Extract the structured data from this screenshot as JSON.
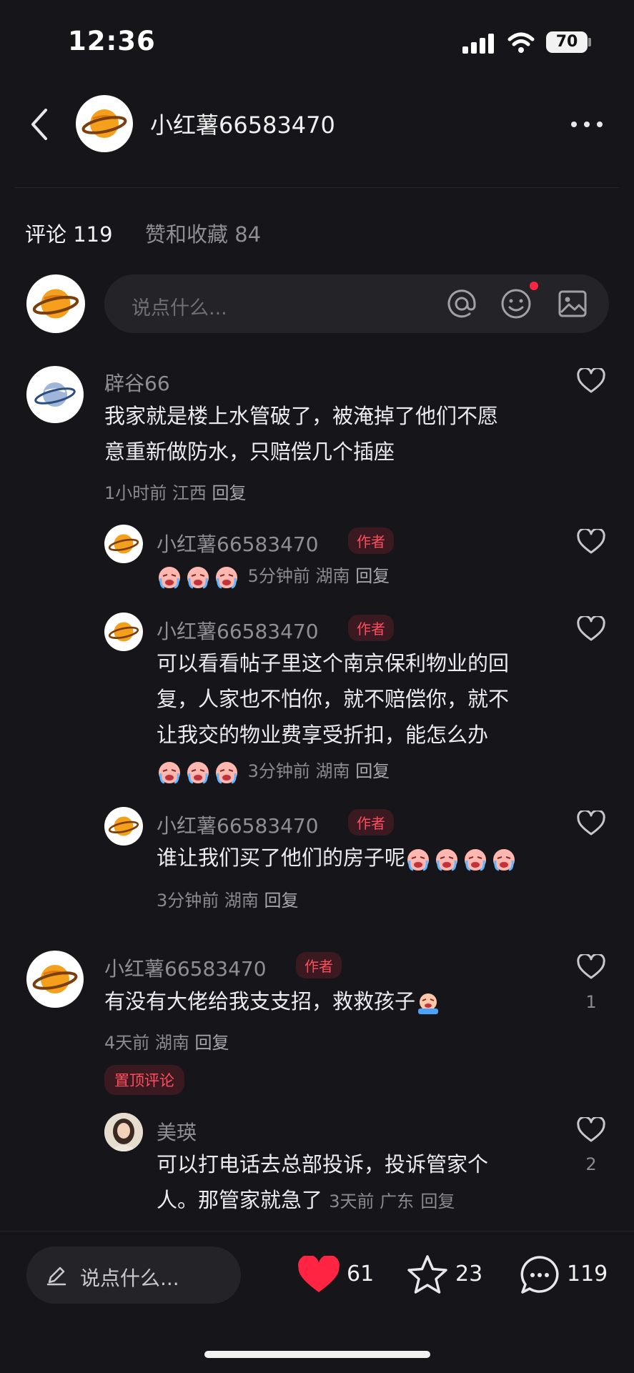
{
  "status_bar": {
    "time": "12:36",
    "battery": "70"
  },
  "header": {
    "title": "小红薯66583470"
  },
  "tabs": {
    "comments": "评论 119",
    "likes_collects": "赞和收藏 84"
  },
  "comment_input": {
    "placeholder": "说点什么..."
  },
  "comments": [
    {
      "name": "辟谷66",
      "text_line1": "我家就是楼上水管破了，被淹掉了他们不愿",
      "text_line2": "意重新做防水，只赔偿几个插座",
      "meta": "1小时前 江西",
      "reply": "回复",
      "replies": [
        {
          "name": "小红薯66583470",
          "tag": "作者",
          "meta": "5分钟前 湖南",
          "reply": "回复"
        },
        {
          "name": "小红薯66583470",
          "tag": "作者",
          "text_line1": "可以看看帖子里这个南京保利物业的回",
          "text_line2": "复，人家也不怕你，就不赔偿你，就不",
          "text_line3": "让我交的物业费享受折扣，能怎么办",
          "meta": "3分钟前 湖南",
          "reply": "回复"
        },
        {
          "name": "小红薯66583470",
          "tag": "作者",
          "text_line1": "谁让我们买了他们的房子呢",
          "meta": "3分钟前 湖南",
          "reply": "回复"
        }
      ]
    },
    {
      "name": "小红薯66583470",
      "tag": "作者",
      "text_line1": "有没有大佬给我支支招，救救孩子",
      "meta": "4天前 湖南",
      "reply": "回复",
      "like_count": "1",
      "pin_tag": "置顶评论",
      "replies": [
        {
          "name": "美瑛",
          "text_line1": "可以打电话去总部投诉，投诉管家个",
          "text_line2": "人。那管家就急了",
          "meta": "3天前 广东",
          "reply": "回复",
          "like_count": "2"
        }
      ]
    }
  ],
  "bottom_bar": {
    "placeholder": "说点什么...",
    "likes": "61",
    "collects": "23",
    "comments": "119"
  },
  "colors": {
    "background": "#16161a",
    "accent_red": "#ff2442",
    "text": "#ececee",
    "muted": "#8e8e93"
  }
}
